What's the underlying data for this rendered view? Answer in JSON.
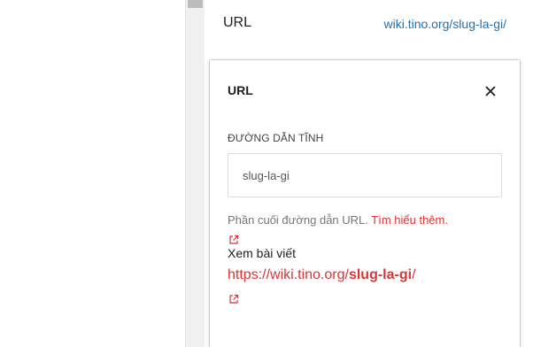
{
  "url_row": {
    "label": "URL",
    "link_text": "wiki.tino.org/slug-la-gi/"
  },
  "popover": {
    "title": "URL",
    "field_label": "ĐƯỜNG DẪN TĨNH",
    "slug_value": "slug-la-gi",
    "help_text": "Phần cuối đường dẫn URL.",
    "help_link": "Tìm hiểu thêm.",
    "view_label": "Xem bài viết",
    "permalink_prefix": "https://wiki.tino.org/",
    "permalink_slug": "slug-la-gi",
    "permalink_suffix": "/"
  },
  "colors": {
    "accent_red": "#d63638",
    "link_blue": "#2271b1"
  },
  "icons": {
    "close": "close-icon",
    "external": "external-link-icon"
  }
}
